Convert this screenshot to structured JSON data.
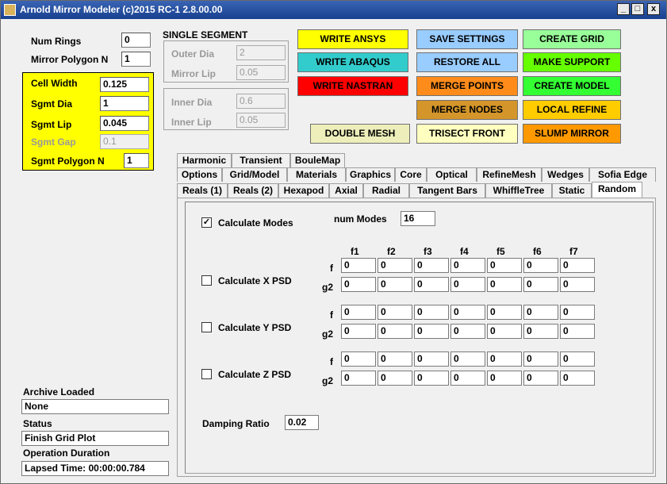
{
  "window": {
    "title": "Arnold Mirror Modeler (c)2015  RC-1 2.8.00.00",
    "min": "_",
    "max": "□",
    "close": "x"
  },
  "left": {
    "num_rings_label": "Num Rings",
    "num_rings_value": "0",
    "mirror_poly_label": "Mirror Polygon N",
    "mirror_poly_value": "1",
    "cell_width_label": "Cell Width",
    "cell_width_value": "0.125",
    "sgmt_dia_label": "Sgmt Dia",
    "sgmt_dia_value": "1",
    "sgmt_lip_label": "Sgmt Lip",
    "sgmt_lip_value": "0.045",
    "sgmt_gap_label": "Sgmt Gap",
    "sgmt_gap_value": "0.1",
    "sgmt_poly_label": "Sgmt Polygon N",
    "sgmt_poly_value": "1"
  },
  "segment": {
    "title": "SINGLE SEGMENT",
    "outer_dia_label": "Outer Dia",
    "outer_dia_value": "2",
    "mirror_lip_label": "Mirror Lip",
    "mirror_lip_value": "0.05",
    "inner_dia_label": "Inner Dia",
    "inner_dia_value": "0.6",
    "inner_lip_label": "Inner Lip",
    "inner_lip_value": "0.05"
  },
  "buttons": {
    "write_ansys": "WRITE ANSYS",
    "write_abaqus": "WRITE  ABAQUS",
    "write_nastran": "WRITE NASTRAN",
    "double_mesh": "DOUBLE MESH",
    "save_settings": "SAVE SETTINGS",
    "restore_all": "RESTORE ALL",
    "merge_points": "MERGE POINTS",
    "merge_nodes": "MERGE NODES",
    "trisect_front": "TRISECT FRONT",
    "create_grid": "CREATE GRID",
    "make_support": "MAKE  SUPPORT",
    "create_model": "CREATE MODEL",
    "local_refine": "LOCAL REFINE",
    "slump_mirror": "SLUMP MIRROR"
  },
  "colors": {
    "yellow": "#ffff00",
    "cyan": "#33cccc",
    "red": "#ff0000",
    "cream": "#eeeebb",
    "lightblue": "#99ccff",
    "orange": "#ff8c1a",
    "darkorange": "#d4962a",
    "lightcream": "#ffffc0",
    "lightgreen": "#99ff99",
    "green": "#66ff00",
    "brightgreen": "#33ff33",
    "gold": "#ffcc00",
    "amber": "#ff9900"
  },
  "tabs": {
    "row1": [
      "Harmonic",
      "Transient",
      "BouleMap"
    ],
    "row2": [
      "Options",
      "Grid/Model",
      "Materials",
      "Graphics",
      "Core",
      "Optical",
      "RefineMesh",
      "Wedges",
      "Sofia Edge"
    ],
    "row3": [
      "Reals (1)",
      "Reals (2)",
      "Hexapod",
      "Axial",
      "Radial",
      "Tangent Bars",
      "WhiffleTree",
      "Static",
      "Random"
    ]
  },
  "random": {
    "calc_modes_label": "Calculate Modes",
    "calc_modes_checked": "✓",
    "num_modes_label": "num Modes",
    "num_modes_value": "16",
    "freq_headers": [
      "f1",
      "f2",
      "f3",
      "f4",
      "f5",
      "f6",
      "f7"
    ],
    "f_label": "f",
    "g2_label": "g2",
    "psd_rows": [
      {
        "label": "Calculate X PSD",
        "f": [
          "0",
          "0",
          "0",
          "0",
          "0",
          "0",
          "0"
        ],
        "g2": [
          "0",
          "0",
          "0",
          "0",
          "0",
          "0",
          "0"
        ]
      },
      {
        "label": "Calculate Y PSD",
        "f": [
          "0",
          "0",
          "0",
          "0",
          "0",
          "0",
          "0"
        ],
        "g2": [
          "0",
          "0",
          "0",
          "0",
          "0",
          "0",
          "0"
        ]
      },
      {
        "label": "Calculate Z PSD",
        "f": [
          "0",
          "0",
          "0",
          "0",
          "0",
          "0",
          "0"
        ],
        "g2": [
          "0",
          "0",
          "0",
          "0",
          "0",
          "0",
          "0"
        ]
      }
    ],
    "damping_label": "Damping Ratio",
    "damping_value": "0.02"
  },
  "status": {
    "archive_label": "Archive Loaded",
    "archive_value": "None",
    "status_label": "Status",
    "status_value": "Finish Grid Plot",
    "duration_label": "Operation Duration",
    "duration_value": "Lapsed Time: 00:00:00.784"
  }
}
